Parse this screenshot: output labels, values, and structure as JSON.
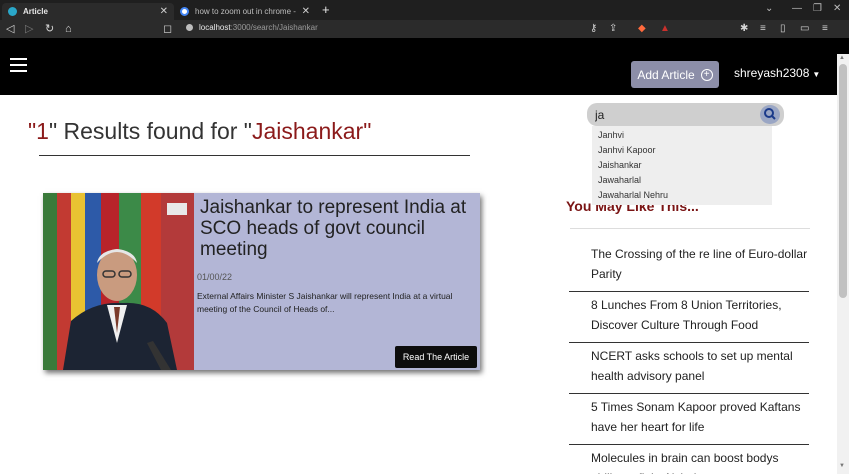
{
  "browser": {
    "tabs": [
      {
        "title": "Article",
        "active": true
      },
      {
        "title": "how to zoom out in chrome - Google",
        "active": false
      }
    ],
    "new_tab_label": "+",
    "address": {
      "host": "localhost",
      "path": ":3000/search/Jaishankar"
    }
  },
  "navbar": {
    "add_article_label": "Add Article",
    "username": "shreyash2308"
  },
  "search": {
    "value": "ja",
    "suggestions": [
      "Janhvi",
      "Janhvi Kapoor",
      "Jaishankar",
      "Jawaharlal",
      "Jawaharlal Nehru"
    ]
  },
  "results": {
    "open_quote": "\"",
    "count": "1",
    "mid_text": "\" Results found for \"",
    "query": "Jaishankar",
    "close_quote": "\""
  },
  "article": {
    "title": "Jaishankar to represent India at SCO heads of govt council meeting",
    "date": "01/00/22",
    "description": "External Affairs Minister S Jaishankar will represent India at a virtual meeting of the Council of Heads of...",
    "read_label": "Read The Article"
  },
  "sidebar": {
    "heading": "You May Like This...",
    "items": [
      {
        "label": "The Crossing of the re line of Euro-dollar Parity"
      },
      {
        "label": "8 Lunches From 8 Union Territories, Discover Culture Through Food"
      },
      {
        "label": "NCERT asks schools to set up mental health advisory panel"
      },
      {
        "label": "5 Times Sonam Kapoor proved Kaftans have her heart for life"
      },
      {
        "label": "Molecules in brain can boost bodys ability to fight Alzheimers"
      }
    ]
  },
  "colors": {
    "navbar_bg": "#000000",
    "accent_red": "#8b1a1a",
    "card_bg": "#b3b6d6",
    "add_button_bg": "#8c8ea8"
  }
}
